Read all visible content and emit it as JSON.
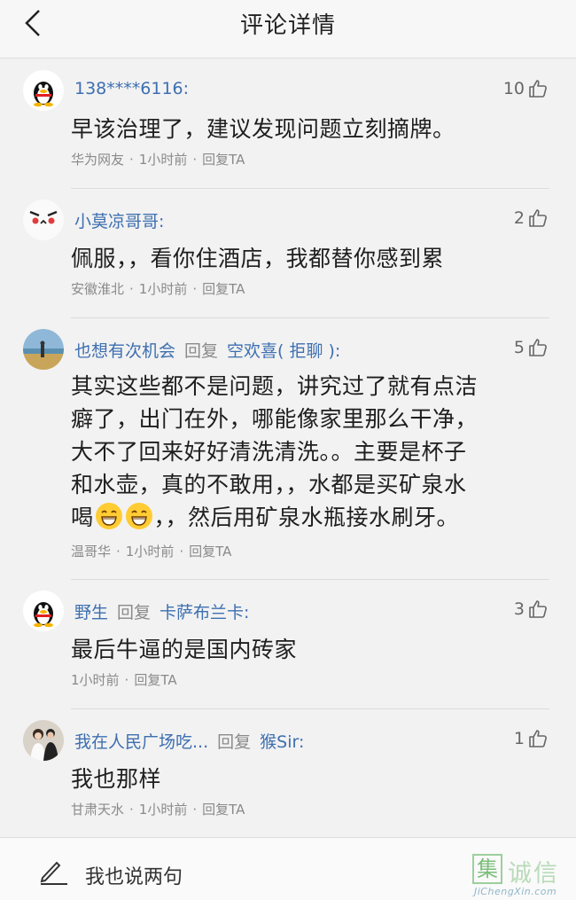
{
  "header": {
    "title": "评论详情"
  },
  "comments": [
    {
      "author": "138****6116:",
      "reply_word": "",
      "target": "",
      "likes": "10",
      "body": "早该治理了，建议发现问题立刻摘牌。",
      "location": "华为网友",
      "time": "1小时前",
      "reply_ta": "回复TA",
      "avatar": "qq-penguin-avatar"
    },
    {
      "author": "小莫凉哥哥:",
      "reply_word": "",
      "target": "",
      "likes": "2",
      "body": "佩服，，看你住酒店，我都替你感到累",
      "location": "安徽淮北",
      "time": "1小时前",
      "reply_ta": "回复TA",
      "avatar": "cartoon-face-avatar"
    },
    {
      "author": "也想有次机会",
      "reply_word": "回复",
      "target": "空欢喜( 拒聊 ):",
      "likes": "5",
      "body_lines": [
        "其实这些都不是问题，讲究过了就有点洁",
        "癖了，出门在外，哪能像家里那么干净，",
        "大不了回来好好清洗清洗。。主要是杯子",
        "和水壶，真的不敢用，，水都是买矿泉水"
      ],
      "body_last_prefix": "喝",
      "body_last_suffix": "，，然后用矿泉水瓶接水刷牙。",
      "location": "温哥华",
      "time": "1小时前",
      "reply_ta": "回复TA",
      "avatar": "beach-photo-avatar"
    },
    {
      "author": "野生",
      "reply_word": "回复",
      "target": "卡萨布兰卡:",
      "likes": "3",
      "body": "最后牛逼的是国内砖家",
      "location": "",
      "time": "1小时前",
      "reply_ta": "回复TA",
      "avatar": "qq-penguin-avatar"
    },
    {
      "author": "我在人民广场吃...",
      "reply_word": "回复",
      "target": "猴Sir:",
      "likes": "1",
      "body": "我也那样",
      "location": "甘肃天水",
      "time": "1小时前",
      "reply_ta": "回复TA",
      "avatar": "couple-photo-avatar"
    }
  ],
  "footer": {
    "input_hint": "我也说两句"
  },
  "watermark": {
    "char": "集",
    "text": "诚信",
    "url": "JiChengXin.com"
  },
  "colors": {
    "link": "#3d6fb0",
    "meta": "#8a8a8a",
    "background": "#f2f2f2"
  }
}
